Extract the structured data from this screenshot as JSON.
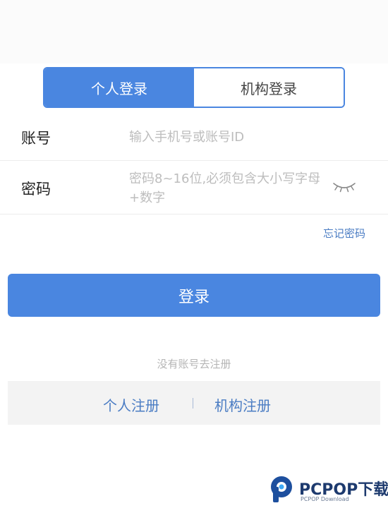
{
  "tabs": {
    "personal_login": "个人登录",
    "org_login": "机构登录"
  },
  "account": {
    "label": "账号",
    "placeholder": "输入手机号或账号ID"
  },
  "password": {
    "label": "密码",
    "placeholder": "密码8~16位,必须包含大小写字母+数字"
  },
  "forgot_password": "忘记密码",
  "login_button": "登录",
  "no_account_hint": "没有账号去注册",
  "register": {
    "personal": "个人注册",
    "separator": "|",
    "org": "机构注册"
  },
  "watermark": {
    "name": "PCPOP下载",
    "sub": "PCPOP Download"
  },
  "colors": {
    "primary": "#4a86e0",
    "link": "#4a7cc3",
    "placeholder": "#bdbdbd",
    "register_bar": "#f3f3f3"
  },
  "icons": {
    "password_toggle": "eye-closed-icon",
    "watermark_logo": "pcpop-logo-icon"
  }
}
